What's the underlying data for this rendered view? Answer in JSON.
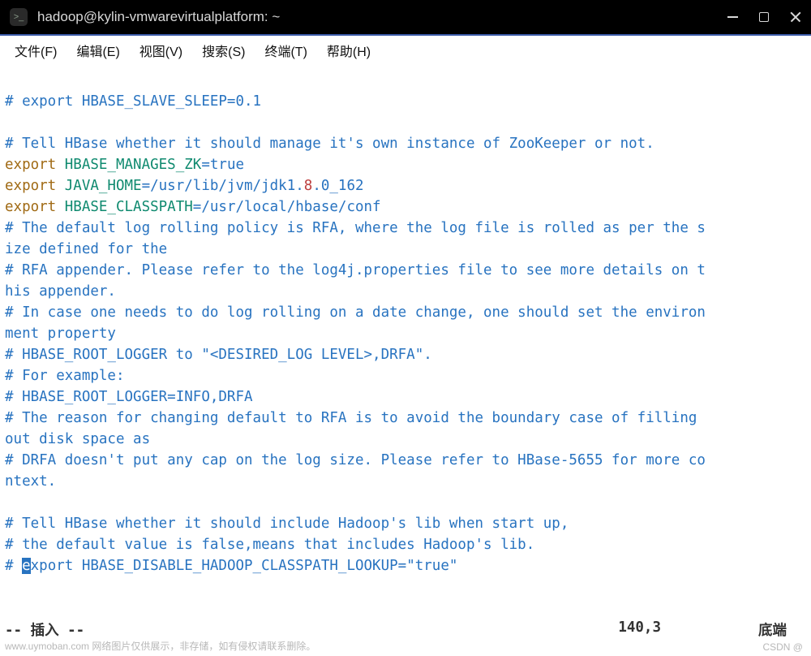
{
  "window": {
    "title": "hadoop@kylin-vmwarevirtualplatform: ~",
    "icon_glyph": ">_"
  },
  "menu": {
    "file": "文件(F)",
    "edit": "编辑(E)",
    "view": "视图(V)",
    "search": "搜索(S)",
    "terminal": "终端(T)",
    "help": "帮助(H)"
  },
  "lines": {
    "l1": "# export HBASE_SLAVE_SLEEP=0.1",
    "l2": "",
    "l3": "# Tell HBase whether it should manage it's own instance of ZooKeeper or not.",
    "l4_kw": "export",
    "l4_var": " HBASE_MANAGES_ZK",
    "l4_rest": "=true",
    "l5_kw": "export",
    "l5_var": " JAVA_HOME",
    "l5_a": "=/usr/lib/jvm/jdk1.",
    "l5_num": "8",
    "l5_b": ".0_162",
    "l6_kw": "export",
    "l6_var": " HBASE_CLASSPATH",
    "l6_rest": "=/usr/local/hbase/conf",
    "l7": "# The default log rolling policy is RFA, where the log file is rolled as per the s",
    "l8": "ize defined for the",
    "l9": "# RFA appender. Please refer to the log4j.properties file to see more details on t",
    "l10": "his appender.",
    "l11": "# In case one needs to do log rolling on a date change, one should set the environ",
    "l12": "ment property",
    "l13": "# HBASE_ROOT_LOGGER to \"<DESIRED_LOG LEVEL>,DRFA\".",
    "l14": "# For example:",
    "l15": "# HBASE_ROOT_LOGGER=INFO,DRFA",
    "l16": "# The reason for changing default to RFA is to avoid the boundary case of filling ",
    "l17": "out disk space as",
    "l18": "# DRFA doesn't put any cap on the log size. Please refer to HBase-5655 for more co",
    "l19": "ntext.",
    "l20": "",
    "l21": "# Tell HBase whether it should include Hadoop's lib when start up,",
    "l22": "# the default value is false,means that includes Hadoop's lib.",
    "l23_pre": "# ",
    "l23_cur": "e",
    "l23_post": "xport HBASE_DISABLE_HADOOP_CLASSPATH_LOOKUP=\"true\""
  },
  "status": {
    "mode": "-- 插入 --",
    "position": "140,3",
    "bottom": "底端"
  },
  "watermark": {
    "left": "www.uymoban.com 网络图片仅供展示，非存储，如有侵权请联系删除。",
    "right": "CSDN @"
  }
}
